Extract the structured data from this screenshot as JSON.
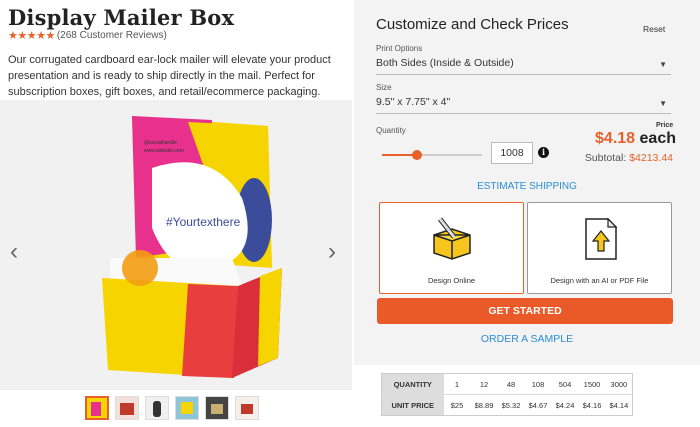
{
  "product": {
    "title": "Display Mailer Box",
    "stars": "★★★★★",
    "reviews": "(268 Customer Reviews)",
    "description": "Our corrugated cardboard ear-lock mailer will elevate your product presentation and is ready to ship directly in the mail. Perfect for subscription boxes, gift boxes, and retail/ecommerce packaging.",
    "box_text": "#Yourtexthere",
    "box_handle": "@socialhandle",
    "box_site": "www.website.com",
    "rating_value": 4.5
  },
  "gallery": {
    "prev_icon": "chevron-left-icon",
    "next_icon": "chevron-right-icon",
    "prev": "‹",
    "next": "›",
    "thumbnails": [
      "thumb-1",
      "thumb-2",
      "thumb-3",
      "thumb-4",
      "thumb-5",
      "thumb-6"
    ],
    "active_thumbnail": 0
  },
  "panel": {
    "title": "Customize and Check Prices",
    "reset": "Reset",
    "print_options_label": "Print Options",
    "print_options_value": "Both Sides (Inside & Outside)",
    "size_label": "Size",
    "size_value": "9.5\" x 7.75\" x 4\"",
    "quantity_label": "Quantity",
    "quantity_value": "1008",
    "quantity_slider_fraction": 0.35,
    "info": "i",
    "price_label": "Price",
    "price": "$4.18",
    "price_unit": "each",
    "subtotal_label": "Subtotal:",
    "subtotal_value": "$4213.44",
    "estimate_shipping": "ESTIMATE SHIPPING",
    "design_online": "Design Online",
    "design_file": "Design with an AI or PDF File",
    "get_started": "GET STARTED",
    "order_sample": "ORDER A SAMPLE"
  },
  "price_table": {
    "quantity_header": "QUANTITY",
    "unit_price_header": "UNIT PRICE",
    "quantities": [
      "1",
      "12",
      "48",
      "108",
      "504",
      "1500",
      "3000"
    ],
    "prices": [
      "$25",
      "$8.89",
      "$5.32",
      "$4.67",
      "$4.24",
      "$4.16",
      "$4.14"
    ]
  },
  "colors": {
    "accent": "#e8602a",
    "link": "#2a8ed6",
    "panel_bg": "#f3f3f3"
  }
}
